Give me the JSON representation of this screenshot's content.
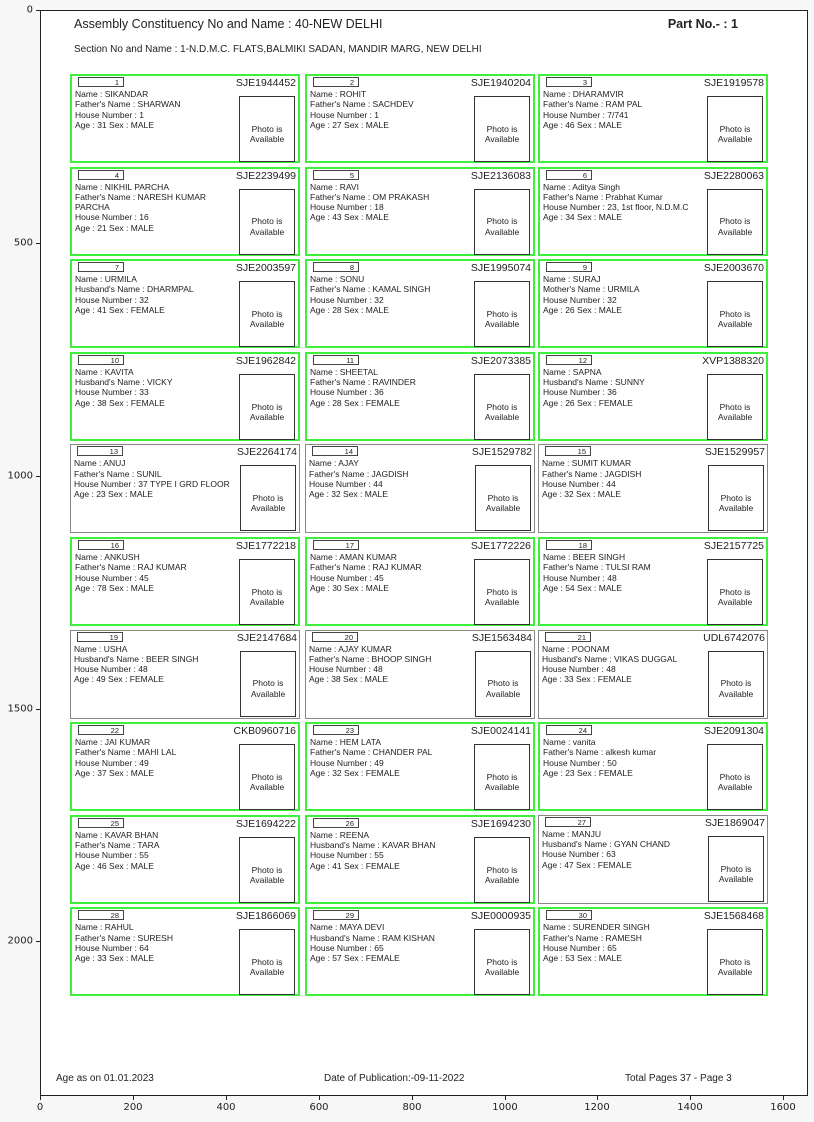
{
  "header": {
    "title": "Assembly Constituency No and Name : 40-NEW DELHI",
    "part": "Part No.- : 1",
    "section": "Section No and Name : 1-N.D.M.C. FLATS,BALMIKI SADAN, MANDIR MARG, NEW DELHI"
  },
  "photo_text": [
    "Photo is",
    "Available"
  ],
  "cards": [
    {
      "serial": "1",
      "epic": "SJE1944452",
      "name": "SIKANDAR",
      "rel_label": "Father's Name",
      "rel_name": "SHARWAN",
      "house": "1",
      "age": "31",
      "sex": "MALE",
      "highlighted": true
    },
    {
      "serial": "2",
      "epic": "SJE1940204",
      "name": "ROHIT",
      "rel_label": "Father's Name",
      "rel_name": "SACHDEV",
      "house": "1",
      "age": "27",
      "sex": "MALE",
      "highlighted": true
    },
    {
      "serial": "3",
      "epic": "SJE1919578",
      "name": "DHARAMVIR",
      "rel_label": "Father's Name",
      "rel_name": "RAM PAL",
      "house": "7/741",
      "age": "46",
      "sex": "MALE",
      "highlighted": true
    },
    {
      "serial": "4",
      "epic": "SJE2239499",
      "name": "NIKHIL PARCHA",
      "rel_label": "Father's Name",
      "rel_name": "NARESH KUMAR PARCHA",
      "house": "16",
      "age": "21",
      "sex": "MALE",
      "highlighted": true
    },
    {
      "serial": "5",
      "epic": "SJE2136083",
      "name": "RAVI",
      "rel_label": "Father's Name",
      "rel_name": "OM PRAKASH",
      "house": "18",
      "age": "43",
      "sex": "MALE",
      "highlighted": true
    },
    {
      "serial": "6",
      "epic": "SJE2280063",
      "name": "Aditya Singh",
      "rel_label": "Father's Name",
      "rel_name": "Prabhat Kumar",
      "house": "23, 1st floor, N.D.M.C",
      "age": "34",
      "sex": "MALE",
      "highlighted": true
    },
    {
      "serial": "7",
      "epic": "SJE2003597",
      "name": "URMILA",
      "rel_label": "Husband's Name",
      "rel_name": "DHARMPAL",
      "house": "32",
      "age": "41",
      "sex": "FEMALE",
      "highlighted": true
    },
    {
      "serial": "8",
      "epic": "SJE1995074",
      "name": "SONU",
      "rel_label": "Father's Name",
      "rel_name": "KAMAL SINGH",
      "house": "32",
      "age": "28",
      "sex": "MALE",
      "highlighted": true
    },
    {
      "serial": "9",
      "epic": "SJE2003670",
      "name": "SURAJ",
      "rel_label": "Mother's Name",
      "rel_name": "URMILA",
      "house": "32",
      "age": "26",
      "sex": "MALE",
      "highlighted": true
    },
    {
      "serial": "10",
      "epic": "SJE1962842",
      "name": "KAVITA",
      "rel_label": "Husband's Name",
      "rel_name": "VICKY",
      "house": "33",
      "age": "38",
      "sex": "FEMALE",
      "highlighted": true
    },
    {
      "serial": "11",
      "epic": "SJE2073385",
      "name": "SHEETAL",
      "rel_label": "Father's Name",
      "rel_name": "RAVINDER",
      "house": "36",
      "age": "28",
      "sex": "FEMALE",
      "highlighted": true
    },
    {
      "serial": "12",
      "epic": "XVP1388320",
      "name": "SAPNA",
      "rel_label": "Husband's Name",
      "rel_name": "SUNNY",
      "house": "36",
      "age": "26",
      "sex": "FEMALE",
      "highlighted": true
    },
    {
      "serial": "13",
      "epic": "SJE2264174",
      "name": "ANUJ",
      "rel_label": "Father's Name",
      "rel_name": "SUNIL",
      "house": "37 TYPE I GRD FLOOR",
      "age": "23",
      "sex": "MALE",
      "highlighted": false
    },
    {
      "serial": "14",
      "epic": "SJE1529782",
      "name": "AJAY",
      "rel_label": "Father's Name",
      "rel_name": "JAGDISH",
      "house": "44",
      "age": "32",
      "sex": "MALE",
      "highlighted": false
    },
    {
      "serial": "15",
      "epic": "SJE1529957",
      "name": "SUMIT KUMAR",
      "rel_label": "Father's Name",
      "rel_name": "JAGDISH",
      "house": "44",
      "age": "32",
      "sex": "MALE",
      "highlighted": false
    },
    {
      "serial": "16",
      "epic": "SJE1772218",
      "name": "ANKUSH",
      "rel_label": "Father's Name",
      "rel_name": "RAJ KUMAR",
      "house": "45",
      "age": "78",
      "sex": "MALE",
      "highlighted": true
    },
    {
      "serial": "17",
      "epic": "SJE1772226",
      "name": "AMAN KUMAR",
      "rel_label": "Father's Name",
      "rel_name": "RAJ KUMAR",
      "house": "45",
      "age": "30",
      "sex": "MALE",
      "highlighted": true
    },
    {
      "serial": "18",
      "epic": "SJE2157725",
      "name": "BEER SINGH",
      "rel_label": "Father's Name",
      "rel_name": "TULSI RAM",
      "house": "48",
      "age": "54",
      "sex": "MALE",
      "highlighted": true
    },
    {
      "serial": "19",
      "epic": "SJE2147684",
      "name": "USHA",
      "rel_label": "Husband's Name",
      "rel_name": "BEER SINGH",
      "house": "48",
      "age": "49",
      "sex": "FEMALE",
      "highlighted": false
    },
    {
      "serial": "20",
      "epic": "SJE1563484",
      "name": "AJAY KUMAR",
      "rel_label": "Father's Name",
      "rel_name": "BHOOP SINGH",
      "house": "48",
      "age": "38",
      "sex": "MALE",
      "highlighted": false
    },
    {
      "serial": "21",
      "epic": "UDL6742076",
      "name": "POONAM",
      "rel_label": "Husband's Name",
      "rel_name": "VIKAS DUGGAL",
      "house": "48",
      "age": "33",
      "sex": "FEMALE",
      "highlighted": false
    },
    {
      "serial": "22",
      "epic": "CKB0960716",
      "name": "JAI KUMAR",
      "rel_label": "Father's Name",
      "rel_name": "MAHI LAL",
      "house": "49",
      "age": "37",
      "sex": "MALE",
      "highlighted": true
    },
    {
      "serial": "23",
      "epic": "SJE0024141",
      "name": "HEM LATA",
      "rel_label": "Father's Name",
      "rel_name": "CHANDER PAL",
      "house": "49",
      "age": "32",
      "sex": "FEMALE",
      "highlighted": true
    },
    {
      "serial": "24",
      "epic": "SJE2091304",
      "name": "vanita",
      "rel_label": "Father's Name",
      "rel_name": "alkesh kumar",
      "house": "50",
      "age": "23",
      "sex": "FEMALE",
      "highlighted": true
    },
    {
      "serial": "25",
      "epic": "SJE1694222",
      "name": "KAVAR BHAN",
      "rel_label": "Father's Name",
      "rel_name": "TARA",
      "house": "55",
      "age": "46",
      "sex": "MALE",
      "highlighted": true
    },
    {
      "serial": "26",
      "epic": "SJE1694230",
      "name": "REENA",
      "rel_label": "Husband's Name",
      "rel_name": "KAVAR BHAN",
      "house": "55",
      "age": "41",
      "sex": "FEMALE",
      "highlighted": true
    },
    {
      "serial": "27",
      "epic": "SJE1869047",
      "name": "MANJU",
      "rel_label": "Husband's Name",
      "rel_name": "GYAN CHAND",
      "house": "63",
      "age": "47",
      "sex": "FEMALE",
      "highlighted": false
    },
    {
      "serial": "28",
      "epic": "SJE1866069",
      "name": "RAHUL",
      "rel_label": "Father's Name",
      "rel_name": "SURESH",
      "house": "64",
      "age": "33",
      "sex": "MALE",
      "highlighted": true
    },
    {
      "serial": "29",
      "epic": "SJE0000935",
      "name": "MAYA DEVI",
      "rel_label": "Husband's Name",
      "rel_name": "RAM KISHAN",
      "house": "65",
      "age": "57",
      "sex": "FEMALE",
      "highlighted": true
    },
    {
      "serial": "30",
      "epic": "SJE1568468",
      "name": "SURENDER SINGH",
      "rel_label": "Father's Name",
      "rel_name": "RAMESH",
      "house": "65",
      "age": "53",
      "sex": "MALE",
      "highlighted": true
    }
  ],
  "labels": {
    "name": "Name",
    "house": "House Number",
    "age": "Age",
    "sex": "Sex"
  },
  "footer": {
    "age_as_on": "Age as on 01.01.2023",
    "publication": "Date of Publication:-09-11-2022",
    "pages": "Total Pages  37  - Page  3"
  },
  "axes": {
    "y_ticks": [
      "0",
      "500",
      "1000",
      "1500",
      "2000"
    ],
    "x_ticks": [
      "0",
      "200",
      "400",
      "600",
      "800",
      "1000",
      "1200",
      "1400",
      "1600"
    ]
  },
  "colors": {
    "highlight": "#3cf03c",
    "border": "#888888"
  }
}
